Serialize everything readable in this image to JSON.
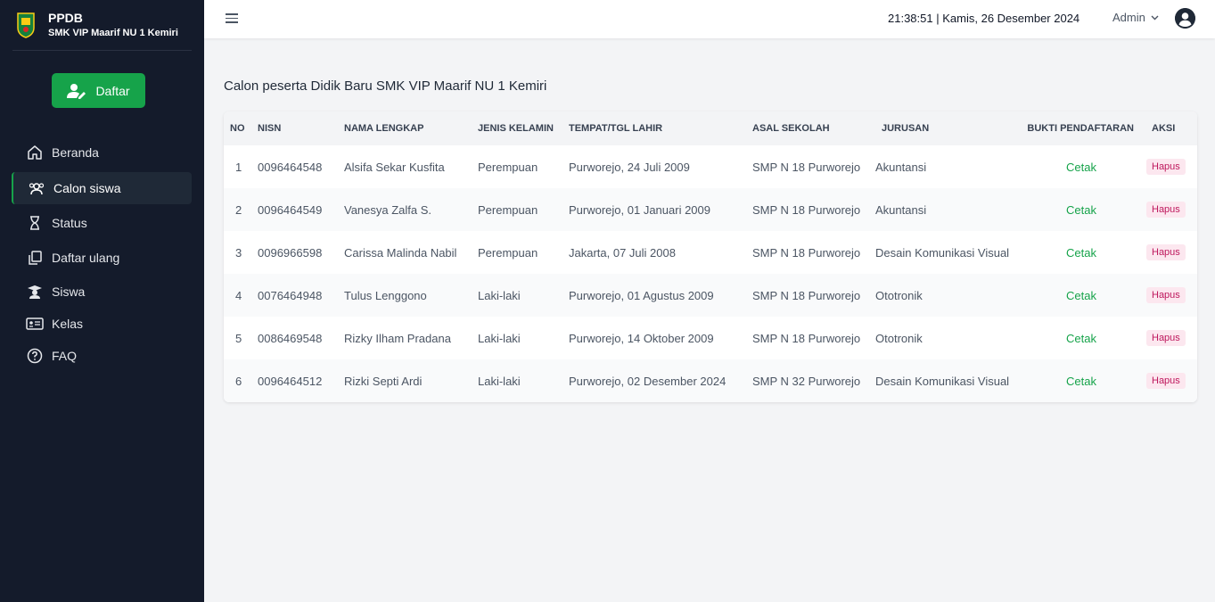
{
  "brand": {
    "title": "PPDB",
    "subtitle": "SMK VIP Maarif NU 1 Kemiri"
  },
  "sidebar": {
    "daftar_label": "Daftar",
    "items": [
      {
        "label": "Beranda",
        "icon": "home-icon"
      },
      {
        "label": "Calon siswa",
        "icon": "users-icon",
        "active": true
      },
      {
        "label": "Status",
        "icon": "hourglass-icon"
      },
      {
        "label": "Daftar ulang",
        "icon": "copy-icon"
      },
      {
        "label": "Siswa",
        "icon": "graduate-icon"
      },
      {
        "label": "Kelas",
        "icon": "id-card-icon"
      },
      {
        "label": "FAQ",
        "icon": "question-icon"
      }
    ]
  },
  "header": {
    "time": "21:38:51",
    "separator": "|",
    "date": "Kamis, 26 Desember 2024",
    "user": "Admin"
  },
  "main": {
    "title": "Calon peserta Didik Baru SMK VIP Maarif NU 1 Kemiri",
    "columns": [
      "NO",
      "NISN",
      "NAMA LENGKAP",
      "JENIS KELAMIN",
      "TEMPAT/TGL LAHIR",
      "ASAL SEKOLAH",
      "JURUSAN",
      "BUKTI PENDAFTARAN",
      "AKSI"
    ],
    "rows": [
      {
        "no": "1",
        "nisn": "0096464548",
        "nama": "Alsifa Sekar Kusfita",
        "jk": "Perempuan",
        "ttl": "Purworejo, 24 Juli 2009",
        "asal": "SMP N 18 Purworejo",
        "jurusan": "Akuntansi",
        "bukti": "Cetak",
        "aksi": "Hapus"
      },
      {
        "no": "2",
        "nisn": "0096464549",
        "nama": "Vanesya Zalfa S.",
        "jk": "Perempuan",
        "ttl": "Purworejo, 01 Januari 2009",
        "asal": "SMP N 18 Purworejo",
        "jurusan": "Akuntansi",
        "bukti": "Cetak",
        "aksi": "Hapus"
      },
      {
        "no": "3",
        "nisn": "0096966598",
        "nama": "Carissa Malinda Nabil",
        "jk": "Perempuan",
        "ttl": "Jakarta, 07 Juli 2008",
        "asal": "SMP N 18 Purworejo",
        "jurusan": "Desain Komunikasi Visual",
        "bukti": "Cetak",
        "aksi": "Hapus"
      },
      {
        "no": "4",
        "nisn": "0076464948",
        "nama": "Tulus Lenggono",
        "jk": "Laki-laki",
        "ttl": "Purworejo, 01 Agustus 2009",
        "asal": "SMP N 18 Purworejo",
        "jurusan": "Ototronik",
        "bukti": "Cetak",
        "aksi": "Hapus"
      },
      {
        "no": "5",
        "nisn": "0086469548",
        "nama": "Rizky Ilham Pradana",
        "jk": "Laki-laki",
        "ttl": "Purworejo, 14 Oktober 2009",
        "asal": "SMP N 18 Purworejo",
        "jurusan": "Ototronik",
        "bukti": "Cetak",
        "aksi": "Hapus"
      },
      {
        "no": "6",
        "nisn": "0096464512",
        "nama": "Rizki Septi Ardi",
        "jk": "Laki-laki",
        "ttl": "Purworejo, 02 Desember 2024",
        "asal": "SMP N 32 Purworejo",
        "jurusan": "Desain Komunikasi Visual",
        "bukti": "Cetak",
        "aksi": "Hapus"
      }
    ]
  },
  "colors": {
    "sidebar_bg": "#141b2b",
    "accent": "#16a34a",
    "danger_bg": "#fce7ef",
    "danger_text": "#be185d"
  }
}
